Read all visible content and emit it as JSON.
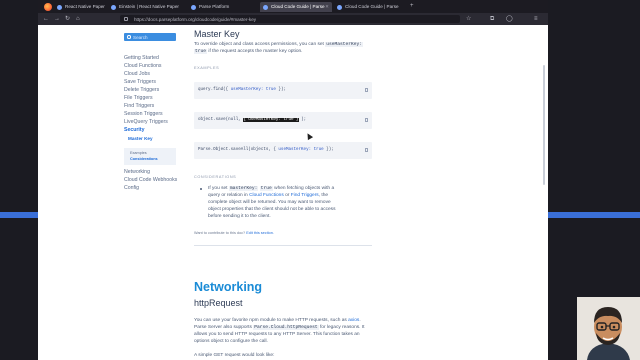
{
  "browser": {
    "tabs": [
      {
        "label": "React Native Paper"
      },
      {
        "label": "Einstein | React Native Paper"
      },
      {
        "label": "Parse Platform"
      },
      {
        "label": "Cloud Code Guide | Parse"
      },
      {
        "label": "Cloud Code Guide | Parse"
      }
    ],
    "active_tab": 3,
    "url": "https://docs.parseplatform.org/cloudcode/guide/#master-key"
  },
  "sidebar": {
    "search_placeholder": "Search",
    "items": [
      {
        "label": "Getting Started"
      },
      {
        "label": "Cloud Functions"
      },
      {
        "label": "Cloud Jobs"
      },
      {
        "label": "Save Triggers"
      },
      {
        "label": "Delete Triggers"
      },
      {
        "label": "File Triggers"
      },
      {
        "label": "Find Triggers"
      },
      {
        "label": "Session Triggers"
      },
      {
        "label": "LiveQuery Triggers"
      },
      {
        "label": "Security"
      }
    ],
    "active_sub": "Master Key",
    "box_lines": [
      "Examples",
      "Considerations"
    ],
    "items_after": [
      {
        "label": "Networking"
      },
      {
        "label": "Cloud Code Webhooks"
      },
      {
        "label": "Config"
      }
    ]
  },
  "main": {
    "heading": "Master Key",
    "intro_line1_a": "To override object and class access permissions, you can set",
    "intro_code1": "useMasterKey:",
    "intro_code2": "true",
    "intro_line2": "if the request accepts the master key option.",
    "examples_label": "EXAMPLES",
    "code1_a": "query.find({",
    "code1_b": "useMasterKey:",
    "code1_c": "true",
    "code1_d": "});",
    "code2_a": "object.save(null,",
    "code2_hl": "{ useMasterKey: true }",
    "code2_d": ");",
    "code3_a": "Parse.Object.saveAll(objects, {",
    "code3_b": "useMasterKey:",
    "code3_c": "true",
    "code3_d": "});",
    "considerations_label": "CONSIDERATIONS",
    "bullet_1a": "If you set",
    "bullet_code_a": "masterKey:",
    "bullet_code_b": "true",
    "bullet_1b": "when fetching objects with a",
    "bullet_2a": "query or relation in",
    "bullet_link1": "Cloud Functions",
    "bullet_2b": "or",
    "bullet_link2": "Find Triggers",
    "bullet_2c": ", the",
    "bullet_3": "complete object will be returned. You may want to remove",
    "bullet_4": "object properties that the client should not be able to access",
    "bullet_5": "before sending it to the client.",
    "contribute_a": "Want to contribute to this doc?",
    "contribute_link": "Edit this section.",
    "networking_heading": "Networking",
    "http_heading": "httpRequest",
    "net_1a": "You can use your favorite npm module to make HTTP requests, such as",
    "net_link": "axios",
    "net_1b": ".",
    "net_2a": "Parse Server also supports",
    "net_code": "Parse.Cloud.httpRequest",
    "net_2b": "for legacy reasons. It",
    "net_3": "allows you to send HTTP requests to any HTTP Server. This function takes an",
    "net_4": "options object to configure the call.",
    "net_5": "A simple GET request would look like:"
  }
}
